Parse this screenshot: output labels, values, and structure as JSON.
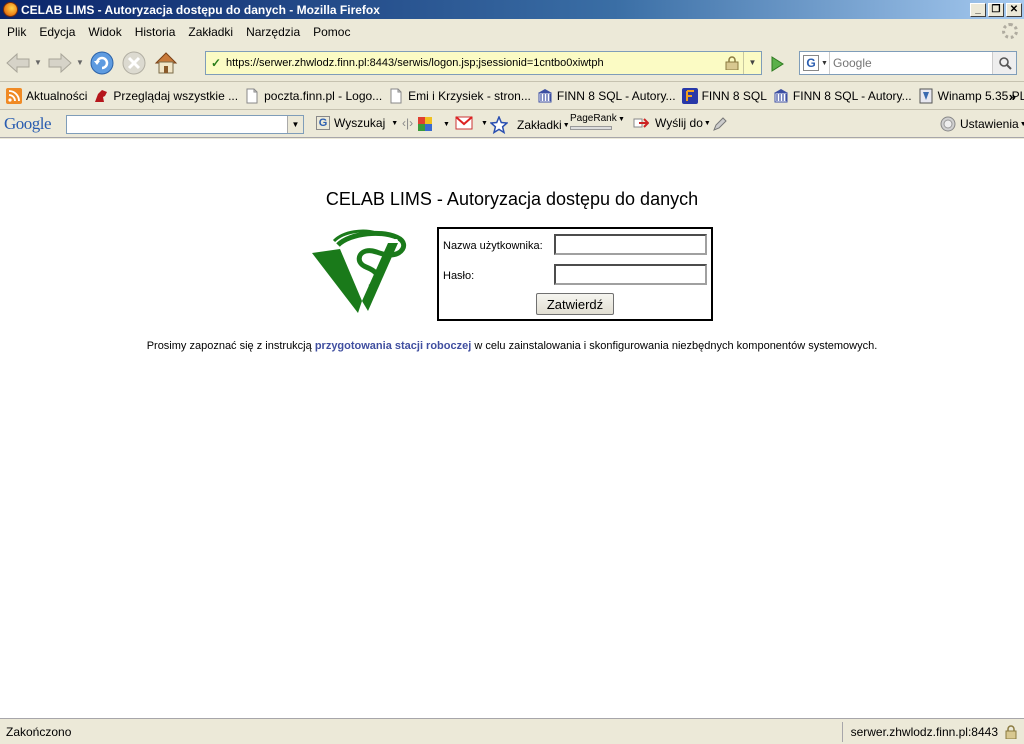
{
  "window": {
    "title": "CELAB LIMS - Autoryzacja dostępu do danych - Mozilla Firefox",
    "min_label": "_",
    "max_label": "❐",
    "close_label": "✕"
  },
  "menu": {
    "items": [
      "Plik",
      "Edycja",
      "Widok",
      "Historia",
      "Zakładki",
      "Narzędzia",
      "Pomoc"
    ]
  },
  "nav": {
    "url": "https://serwer.zhwlodz.finn.pl:8443/serwis/logon.jsp;jsessionid=1cntbo0xiwtph",
    "search_placeholder": "Google",
    "search_engine_letter": "G"
  },
  "bookmarks": {
    "items": [
      {
        "label": "Aktualności",
        "icon": "rss-icon"
      },
      {
        "label": "Przeglądaj wszystkie ...",
        "icon": "stallion-icon"
      },
      {
        "label": "poczta.finn.pl - Logo...",
        "icon": "page-icon"
      },
      {
        "label": "Emi i Krzysiek - stron...",
        "icon": "page-icon"
      },
      {
        "label": "FINN 8 SQL - Autory...",
        "icon": "building-icon"
      },
      {
        "label": "FINN 8 SQL",
        "icon": "finn-icon"
      },
      {
        "label": "FINN 8 SQL - Autory...",
        "icon": "building-icon"
      },
      {
        "label": "Winamp 5.35 PL",
        "icon": "winamp-icon"
      }
    ],
    "more": "»"
  },
  "google_bar": {
    "logo": "Google",
    "search_label": "Wyszukaj",
    "bookmarks_label": "Zakładki",
    "pagerank_label": "PageRank",
    "send_label": "Wyślij do",
    "settings_label": "Ustawienia"
  },
  "page": {
    "title": "CELAB LIMS - Autoryzacja dostępu do danych",
    "username_label": "Nazwa użytkownika:",
    "username_value": "",
    "password_label": "Hasło:",
    "password_value": "",
    "submit_label": "Zatwierdź",
    "info_before": "Prosimy zapoznać się z instrukcją ",
    "info_link": "przygotowania stacji roboczej",
    "info_after": " w celu zainstalowania i skonfigurowania niezbędnych komponentów systemowych."
  },
  "status": {
    "text": "Zakończono",
    "host": "serwer.zhwlodz.finn.pl:8443"
  },
  "colors": {
    "url_bg": "#fbfbc4",
    "link": "#404fa0",
    "logo_green": "#1a7a1a"
  }
}
